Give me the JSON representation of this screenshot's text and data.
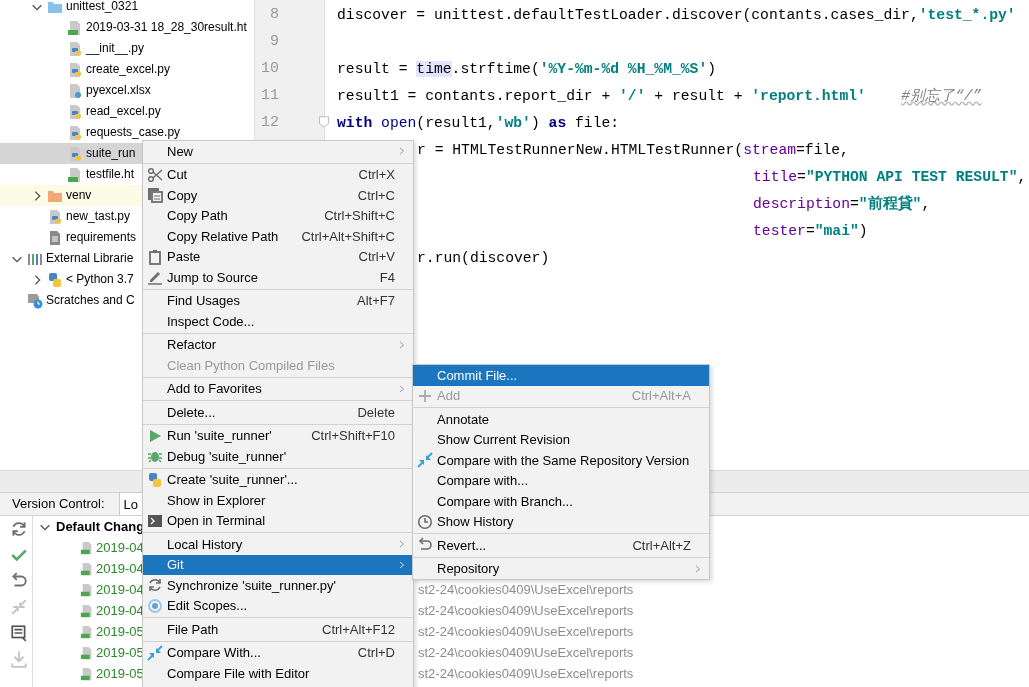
{
  "project_tree": {
    "project_children": [
      {
        "label": "unittest_0321",
        "kind": "folder",
        "expanded": true,
        "selected": false,
        "children": [
          {
            "label": "2019-03-31 18_28_30result.ht",
            "kind": "html",
            "selected": false
          },
          {
            "label": "__init__.py",
            "kind": "python",
            "selected": false
          },
          {
            "label": "create_excel.py",
            "kind": "python",
            "selected": false
          },
          {
            "label": "pyexcel.xlsx",
            "kind": "unknown",
            "selected": false
          },
          {
            "label": "read_excel.py",
            "kind": "python",
            "selected": false
          },
          {
            "label": "requests_case.py",
            "kind": "python",
            "selected": false
          },
          {
            "label": "suite_run",
            "kind": "python",
            "selected": true
          },
          {
            "label": "testfile.ht",
            "kind": "html",
            "selected": false
          }
        ]
      },
      {
        "label": "venv",
        "kind": "excluded-folder",
        "expanded": false,
        "selected": false
      },
      {
        "label": "new_tast.py",
        "kind": "python",
        "selected": false
      },
      {
        "label": "requirements",
        "kind": "text",
        "selected": false
      }
    ],
    "roots": [
      {
        "label": "External Librarie",
        "kind": "libraries",
        "expanded": true,
        "selected": false,
        "children": [
          {
            "label": "< Python 3.7",
            "kind": "sdk",
            "expanded": false,
            "selected": false
          }
        ]
      },
      {
        "label": "Scratches and C",
        "kind": "scratches",
        "selected": false
      }
    ]
  },
  "editor": {
    "lines": [
      {
        "number": "8",
        "kind": "full",
        "tokens": [
          {
            "t": "discover = unittest.defaultTestLoader.discover(contants.cases_dir,",
            "kind": "plain"
          },
          {
            "t": "'test_*.py'",
            "kind": "str"
          }
        ]
      },
      {
        "number": "9",
        "kind": "full"
      },
      {
        "number": "10",
        "kind": "full",
        "tokens": [
          {
            "t": "result = ",
            "kind": "plain"
          },
          {
            "t": "time",
            "kind": "hl"
          },
          {
            "t": ".strftime(",
            "kind": "plain"
          },
          {
            "t": "'%Y-%m-%d %H_%M_%S'",
            "kind": "str"
          },
          {
            "t": ")",
            "kind": "plain"
          }
        ]
      },
      {
        "number": "11",
        "kind": "full",
        "tokens": [
          {
            "t": "result1 = contants.report_dir + ",
            "kind": "plain"
          },
          {
            "t": "'/'",
            "kind": "str"
          },
          {
            "t": " + result + ",
            "kind": "plain"
          },
          {
            "t": "'report.html'",
            "kind": "str"
          },
          {
            "t": "#别忘了“/”",
            "kind": "comment"
          }
        ]
      },
      {
        "number": "12",
        "kind": "full",
        "fold": true,
        "tokens": [
          {
            "t": "with",
            "kind": "kw"
          },
          {
            "t": " open",
            "kind": "builtin"
          },
          {
            "t": "(result1,",
            "kind": "plain"
          },
          {
            "t": "'wb'",
            "kind": "str"
          },
          {
            "t": ") ",
            "kind": "plain"
          },
          {
            "t": "as",
            "kind": "kw"
          },
          {
            "t": " file:",
            "kind": "plain"
          }
        ]
      },
      {
        "kind": "cut",
        "tokens": [
          {
            "t": "r = HTMLTestRunnerNew.HTMLTestRunner(",
            "kind": "plain"
          },
          {
            "t": "stream",
            "kind": "param"
          },
          {
            "t": "=file,",
            "kind": "plain"
          }
        ]
      },
      {
        "kind": "cont",
        "tokens": [
          {
            "t": "title",
            "kind": "param"
          },
          {
            "t": "=",
            "kind": "plain"
          },
          {
            "t": "\"PYTHON API TEST RESULT\"",
            "kind": "str"
          },
          {
            "t": ",",
            "kind": "plain"
          }
        ]
      },
      {
        "kind": "cont",
        "tokens": [
          {
            "t": "description",
            "kind": "param"
          },
          {
            "t": "=",
            "kind": "plain"
          },
          {
            "t": "\"前程貸\"",
            "kind": "str"
          },
          {
            "t": ",",
            "kind": "plain"
          }
        ]
      },
      {
        "kind": "cont",
        "tokens": [
          {
            "t": "tester",
            "kind": "param"
          },
          {
            "t": "=",
            "kind": "plain"
          },
          {
            "t": "\"mai\"",
            "kind": "str"
          },
          {
            "t": ")",
            "kind": "plain"
          }
        ]
      },
      {
        "kind": "cut",
        "tokens": [
          {
            "t": "r.run(discover)",
            "kind": "plain"
          }
        ]
      }
    ]
  },
  "version_control": {
    "label": "Version Control:",
    "tabs": [
      {
        "label": "Lo",
        "selected": true
      }
    ],
    "changelist": {
      "label": "Default Chang",
      "expanded": true,
      "files": [
        {
          "name": "2019-04"
        },
        {
          "name": "2019-04"
        },
        {
          "name": "2019-04",
          "path": "st2-24\\cookies0409\\UseExcel\\reports"
        },
        {
          "name": "2019-04",
          "path": "st2-24\\cookies0409\\UseExcel\\reports"
        },
        {
          "name": "2019-05",
          "path": "st2-24\\cookies0409\\UseExcel\\reports"
        },
        {
          "name": "2019-05",
          "path": "st2-24\\cookies0409\\UseExcel\\reports"
        },
        {
          "name": "2019-05",
          "path": "st2-24\\cookies0409\\UseExcel\\reports"
        }
      ]
    }
  },
  "context_menu": {
    "items": [
      {
        "label": "New",
        "kind": "plain",
        "submenu": true,
        "selected": false,
        "disabled": false
      },
      {
        "label": "Cut",
        "kind": "cut",
        "shortcut": "Ctrl+X",
        "separator_before": true,
        "selected": false,
        "disabled": false
      },
      {
        "label": "Copy",
        "kind": "copy",
        "shortcut": "Ctrl+C",
        "selected": false,
        "disabled": false
      },
      {
        "label": "Copy Path",
        "kind": "plain",
        "shortcut": "Ctrl+Shift+C",
        "selected": false,
        "disabled": false
      },
      {
        "label": "Copy Relative Path",
        "kind": "plain",
        "shortcut": "Ctrl+Alt+Shift+C",
        "selected": false,
        "disabled": false
      },
      {
        "label": "Paste",
        "kind": "paste",
        "shortcut": "Ctrl+V",
        "selected": false,
        "disabled": false
      },
      {
        "label": "Jump to Source",
        "kind": "edit",
        "shortcut": "F4",
        "selected": false,
        "disabled": false
      },
      {
        "label": "Find Usages",
        "kind": "plain",
        "shortcut": "Alt+F7",
        "separator_before": true,
        "selected": false,
        "disabled": false
      },
      {
        "label": "Inspect Code...",
        "kind": "plain",
        "selected": false,
        "disabled": false
      },
      {
        "label": "Refactor",
        "kind": "plain",
        "submenu": true,
        "separator_before": true,
        "selected": false,
        "disabled": false
      },
      {
        "label": "Clean Python Compiled Files",
        "kind": "plain",
        "selected": false,
        "disabled": true
      },
      {
        "label": "Add to Favorites",
        "kind": "plain",
        "submenu": true,
        "separator_before": true,
        "selected": false,
        "disabled": false
      },
      {
        "label": "Delete...",
        "kind": "plain",
        "shortcut": "Delete",
        "separator_before": true,
        "selected": false,
        "disabled": false
      },
      {
        "label": "Run 'suite_runner'",
        "kind": "run",
        "shortcut": "Ctrl+Shift+F10",
        "separator_before": true,
        "selected": false,
        "disabled": false
      },
      {
        "label": "Debug 'suite_runner'",
        "kind": "debug",
        "selected": false,
        "disabled": false
      },
      {
        "label": "Create 'suite_runner'...",
        "kind": "logo",
        "separator_before": true,
        "selected": false,
        "disabled": false
      },
      {
        "label": "Show in Explorer",
        "kind": "plain",
        "selected": false,
        "disabled": false
      },
      {
        "label": "Open in Terminal",
        "kind": "terminal",
        "selected": false,
        "disabled": false
      },
      {
        "label": "Local History",
        "kind": "plain",
        "submenu": true,
        "separator_before": true,
        "selected": false,
        "disabled": false
      },
      {
        "label": "Git",
        "kind": "plain",
        "submenu": true,
        "selected": true,
        "disabled": false
      },
      {
        "label": "Synchronize 'suite_runner.py'",
        "kind": "sync",
        "selected": false,
        "disabled": false
      },
      {
        "label": "Edit Scopes...",
        "kind": "scope",
        "selected": false,
        "disabled": false
      },
      {
        "label": "File Path",
        "kind": "plain",
        "shortcut": "Ctrl+Alt+F12",
        "separator_before": true,
        "selected": false,
        "disabled": false
      },
      {
        "label": "Compare With...",
        "kind": "compare",
        "shortcut": "Ctrl+D",
        "separator_before": true,
        "selected": false,
        "disabled": false
      },
      {
        "label": "Compare File with Editor",
        "kind": "plain",
        "selected": false,
        "disabled": false
      }
    ]
  },
  "git_submenu": {
    "items": [
      {
        "label": "Commit File...",
        "kind": "plain",
        "selected": true,
        "disabled": false
      },
      {
        "label": "Add",
        "kind": "add",
        "shortcut": "Ctrl+Alt+A",
        "selected": false,
        "disabled": true
      },
      {
        "label": "Annotate",
        "kind": "plain",
        "separator_before": true,
        "selected": false,
        "disabled": false
      },
      {
        "label": "Show Current Revision",
        "kind": "plain",
        "selected": false,
        "disabled": false
      },
      {
        "label": "Compare with the Same Repository Version",
        "kind": "compare",
        "selected": false,
        "disabled": false
      },
      {
        "label": "Compare with...",
        "kind": "plain",
        "selected": false,
        "disabled": false
      },
      {
        "label": "Compare with Branch...",
        "kind": "plain",
        "selected": false,
        "disabled": false
      },
      {
        "label": "Show History",
        "kind": "clock",
        "selected": false,
        "disabled": false
      },
      {
        "label": "Revert...",
        "kind": "revert",
        "shortcut": "Ctrl+Alt+Z",
        "separator_before": true,
        "selected": false,
        "disabled": false
      },
      {
        "label": "Repository",
        "kind": "plain",
        "submenu": true,
        "separator_before": true,
        "selected": false,
        "disabled": false
      }
    ]
  }
}
